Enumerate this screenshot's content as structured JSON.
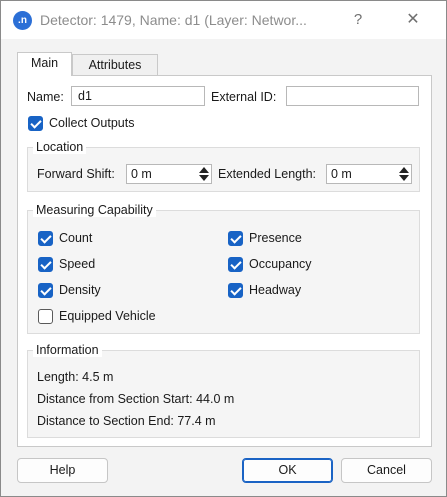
{
  "window": {
    "icon_text": ".n",
    "title": "Detector: 1479, Name: d1 (Layer: Networ...",
    "help_glyph": "?",
    "close_glyph": "✕"
  },
  "tabs": [
    {
      "label": "Main",
      "active": true
    },
    {
      "label": "Attributes",
      "active": false
    }
  ],
  "main": {
    "name_label": "Name:",
    "name_value": "d1",
    "external_id_label": "External ID:",
    "external_id_value": "",
    "collect_outputs_label": "Collect Outputs",
    "collect_outputs_checked": true,
    "location": {
      "title": "Location",
      "forward_shift_label": "Forward Shift:",
      "forward_shift_value": "0 m",
      "extended_length_label": "Extended Length:",
      "extended_length_value": "0 m"
    },
    "measuring": {
      "title": "Measuring Capability",
      "count_label": "Count",
      "speed_label": "Speed",
      "density_label": "Density",
      "equipped_label": "Equipped Vehicle",
      "presence_label": "Presence",
      "occupancy_label": "Occupancy",
      "headway_label": "Headway",
      "checked": {
        "count": true,
        "speed": true,
        "density": true,
        "equipped": false,
        "presence": true,
        "occupancy": true,
        "headway": true
      }
    },
    "information": {
      "title": "Information",
      "length": "Length: 4.5 m",
      "distance_start": "Distance from Section Start: 44.0 m",
      "distance_end": "Distance to Section End: 77.4 m"
    }
  },
  "buttons": {
    "help": "Help",
    "ok": "OK",
    "cancel": "Cancel"
  },
  "colors": {
    "accent": "#1863c5",
    "window_bg": "#f3f3f3",
    "panel_bg": "#ffffff"
  }
}
